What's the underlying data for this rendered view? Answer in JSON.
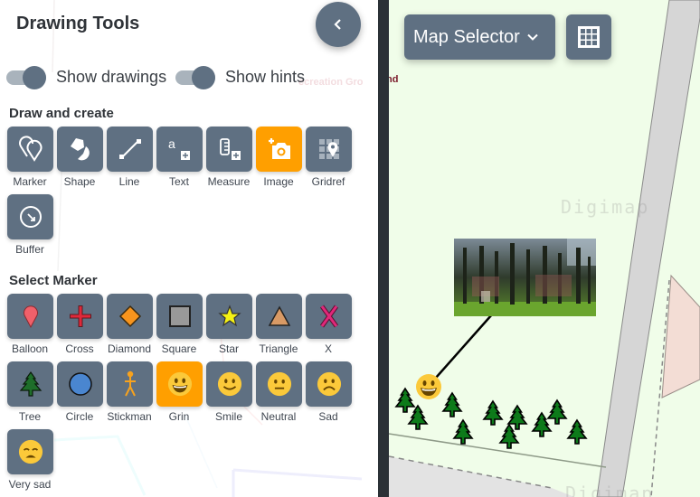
{
  "panel": {
    "title": "Drawing Tools",
    "collapse_icon": "chevron-left-icon",
    "toggles": [
      {
        "label": "Show drawings",
        "on": true
      },
      {
        "label": "Show hints",
        "on": true
      }
    ],
    "draw_section": {
      "title": "Draw and create",
      "tools": [
        {
          "label": "Marker",
          "icon": "marker-icon",
          "active": false
        },
        {
          "label": "Shape",
          "icon": "shape-icon",
          "active": false
        },
        {
          "label": "Line",
          "icon": "line-icon",
          "active": false
        },
        {
          "label": "Text",
          "icon": "text-icon",
          "active": false
        },
        {
          "label": "Measure",
          "icon": "measure-icon",
          "active": false
        },
        {
          "label": "Image",
          "icon": "add-photo-icon",
          "active": true
        },
        {
          "label": "Gridref",
          "icon": "gridref-icon",
          "active": false
        },
        {
          "label": "Buffer",
          "icon": "buffer-icon",
          "active": false
        }
      ]
    },
    "marker_section": {
      "title": "Select Marker",
      "markers": [
        {
          "label": "Balloon",
          "icon": "balloon-icon",
          "active": false,
          "color": "#f0606a"
        },
        {
          "label": "Cross",
          "icon": "cross-icon",
          "active": false,
          "color": "#e0283a"
        },
        {
          "label": "Diamond",
          "icon": "diamond-icon",
          "active": false,
          "color": "#f7941d"
        },
        {
          "label": "Square",
          "icon": "square-icon",
          "active": false,
          "color": "#999999"
        },
        {
          "label": "Star",
          "icon": "star-icon",
          "active": false,
          "color": "#f5f214"
        },
        {
          "label": "Triangle",
          "icon": "triangle-icon",
          "active": false,
          "color": "#d99a65"
        },
        {
          "label": "X",
          "icon": "x-icon",
          "active": false,
          "color": "#e0287a"
        },
        {
          "label": "Tree",
          "icon": "tree-icon",
          "active": false,
          "color": "#1e6e2a"
        },
        {
          "label": "Circle",
          "icon": "circle-icon",
          "active": false,
          "color": "#4a86d0"
        },
        {
          "label": "Stickman",
          "icon": "stickman-icon",
          "active": false,
          "color": "#f7a21d"
        },
        {
          "label": "Grin",
          "icon": "grin-emoji-icon",
          "active": true,
          "color": "#fbc93a"
        },
        {
          "label": "Smile",
          "icon": "smile-emoji-icon",
          "active": false,
          "color": "#fbc93a"
        },
        {
          "label": "Neutral",
          "icon": "neutral-emoji-icon",
          "active": false,
          "color": "#fbc93a"
        },
        {
          "label": "Sad",
          "icon": "sad-emoji-icon",
          "active": false,
          "color": "#fbc93a"
        },
        {
          "label": "Very sad",
          "icon": "very-sad-emoji-icon",
          "active": false,
          "color": "#fbc93a"
        }
      ]
    }
  },
  "map": {
    "selector_label": "Map Selector",
    "grid_button_icon": "grid-icon",
    "place_label": "nd",
    "watermark": "Digimap"
  },
  "colors": {
    "button": "#5f7082",
    "active": "#ff9f00",
    "map_bg": "#f0fde9",
    "road": "#d6d6d6"
  }
}
